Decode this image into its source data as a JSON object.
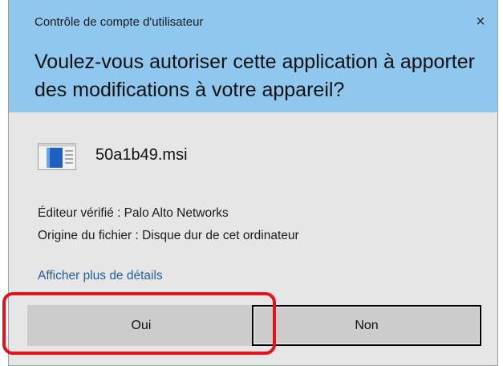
{
  "dialog": {
    "title": "Contrôle de compte d'utilisateur",
    "close_icon": "×",
    "question": "Voulez-vous autoriser cette application à apporter des modifications à votre appareil?",
    "header_color": "#8fc7ee"
  },
  "app": {
    "icon": "installer-window-icon",
    "name": "50a1b49.msi"
  },
  "info": {
    "publisher": "Éditeur vérifié : Palo Alto Networks",
    "origin": "Origine du fichier : Disque dur de cet ordinateur"
  },
  "details_link": "Afficher plus de détails",
  "buttons": {
    "yes": "Oui",
    "no": "Non"
  },
  "annotation": {
    "highlight_color": "#e8101a",
    "highlighted": "yes-button"
  }
}
